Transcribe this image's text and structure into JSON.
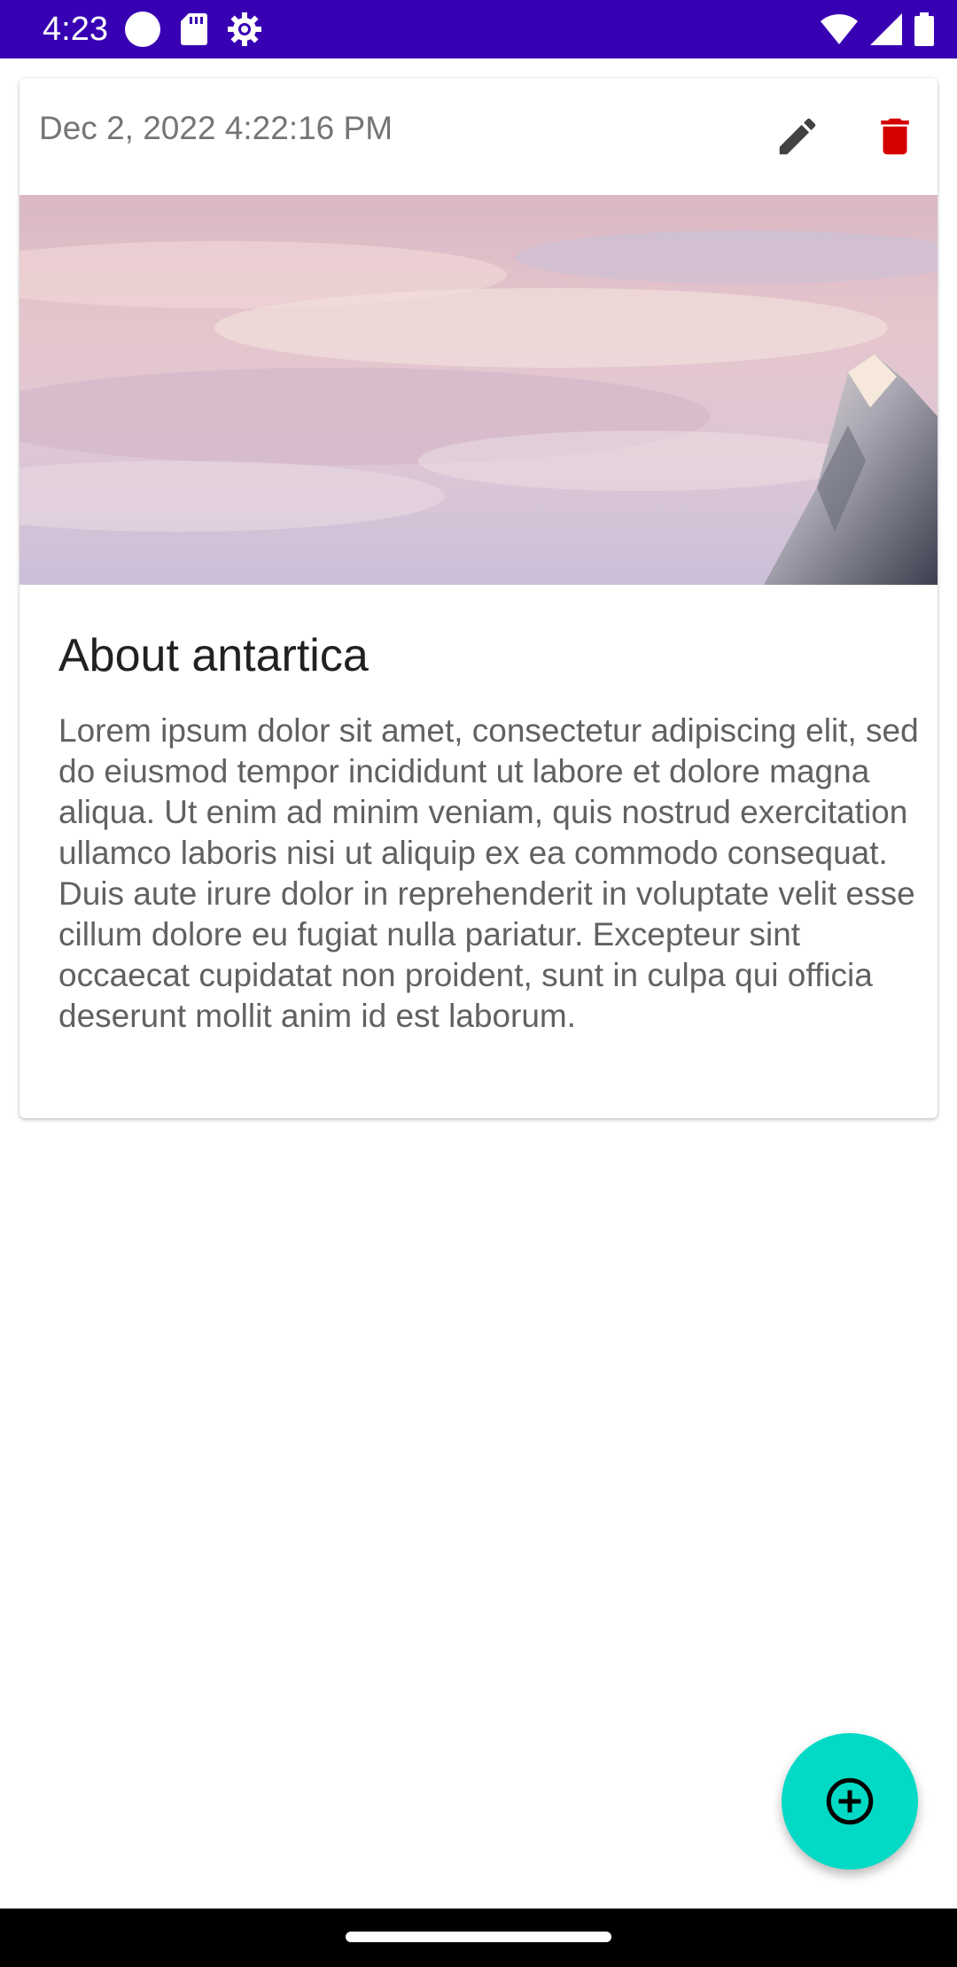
{
  "status_bar": {
    "time": "4:23",
    "background": "#3700b3",
    "left_icons": [
      "circle-notification-icon",
      "sd-card-icon",
      "settings-gear-icon"
    ],
    "right_icons": [
      "wifi-icon",
      "cell-signal-icon",
      "battery-icon"
    ]
  },
  "card": {
    "date": "Dec 2, 2022 4:22:16 PM",
    "edit_icon": "pencil-icon",
    "delete_icon": "trash-icon",
    "delete_color": "#d50000",
    "image": "snowy-mountain-peak-pink-sky-photo",
    "title": "About antartica",
    "body": "Lorem ipsum dolor sit amet, consectetur adipiscing elit, sed do eiusmod tempor incididunt ut labore et dolore magna aliqua. Ut enim ad minim veniam, quis nostrud exercitation ullamco laboris nisi ut aliquip ex ea commodo consequat. Duis aute irure dolor in reprehenderit in voluptate velit esse cillum dolore eu fugiat nulla pariatur. Excepteur sint occaecat cupidatat non proident, sunt in culpa qui officia deserunt mollit anim id est laborum."
  },
  "fab": {
    "icon": "add-circle-icon",
    "color": "#03dac5"
  },
  "nav_bar": {
    "handle": "home-gesture-handle"
  }
}
